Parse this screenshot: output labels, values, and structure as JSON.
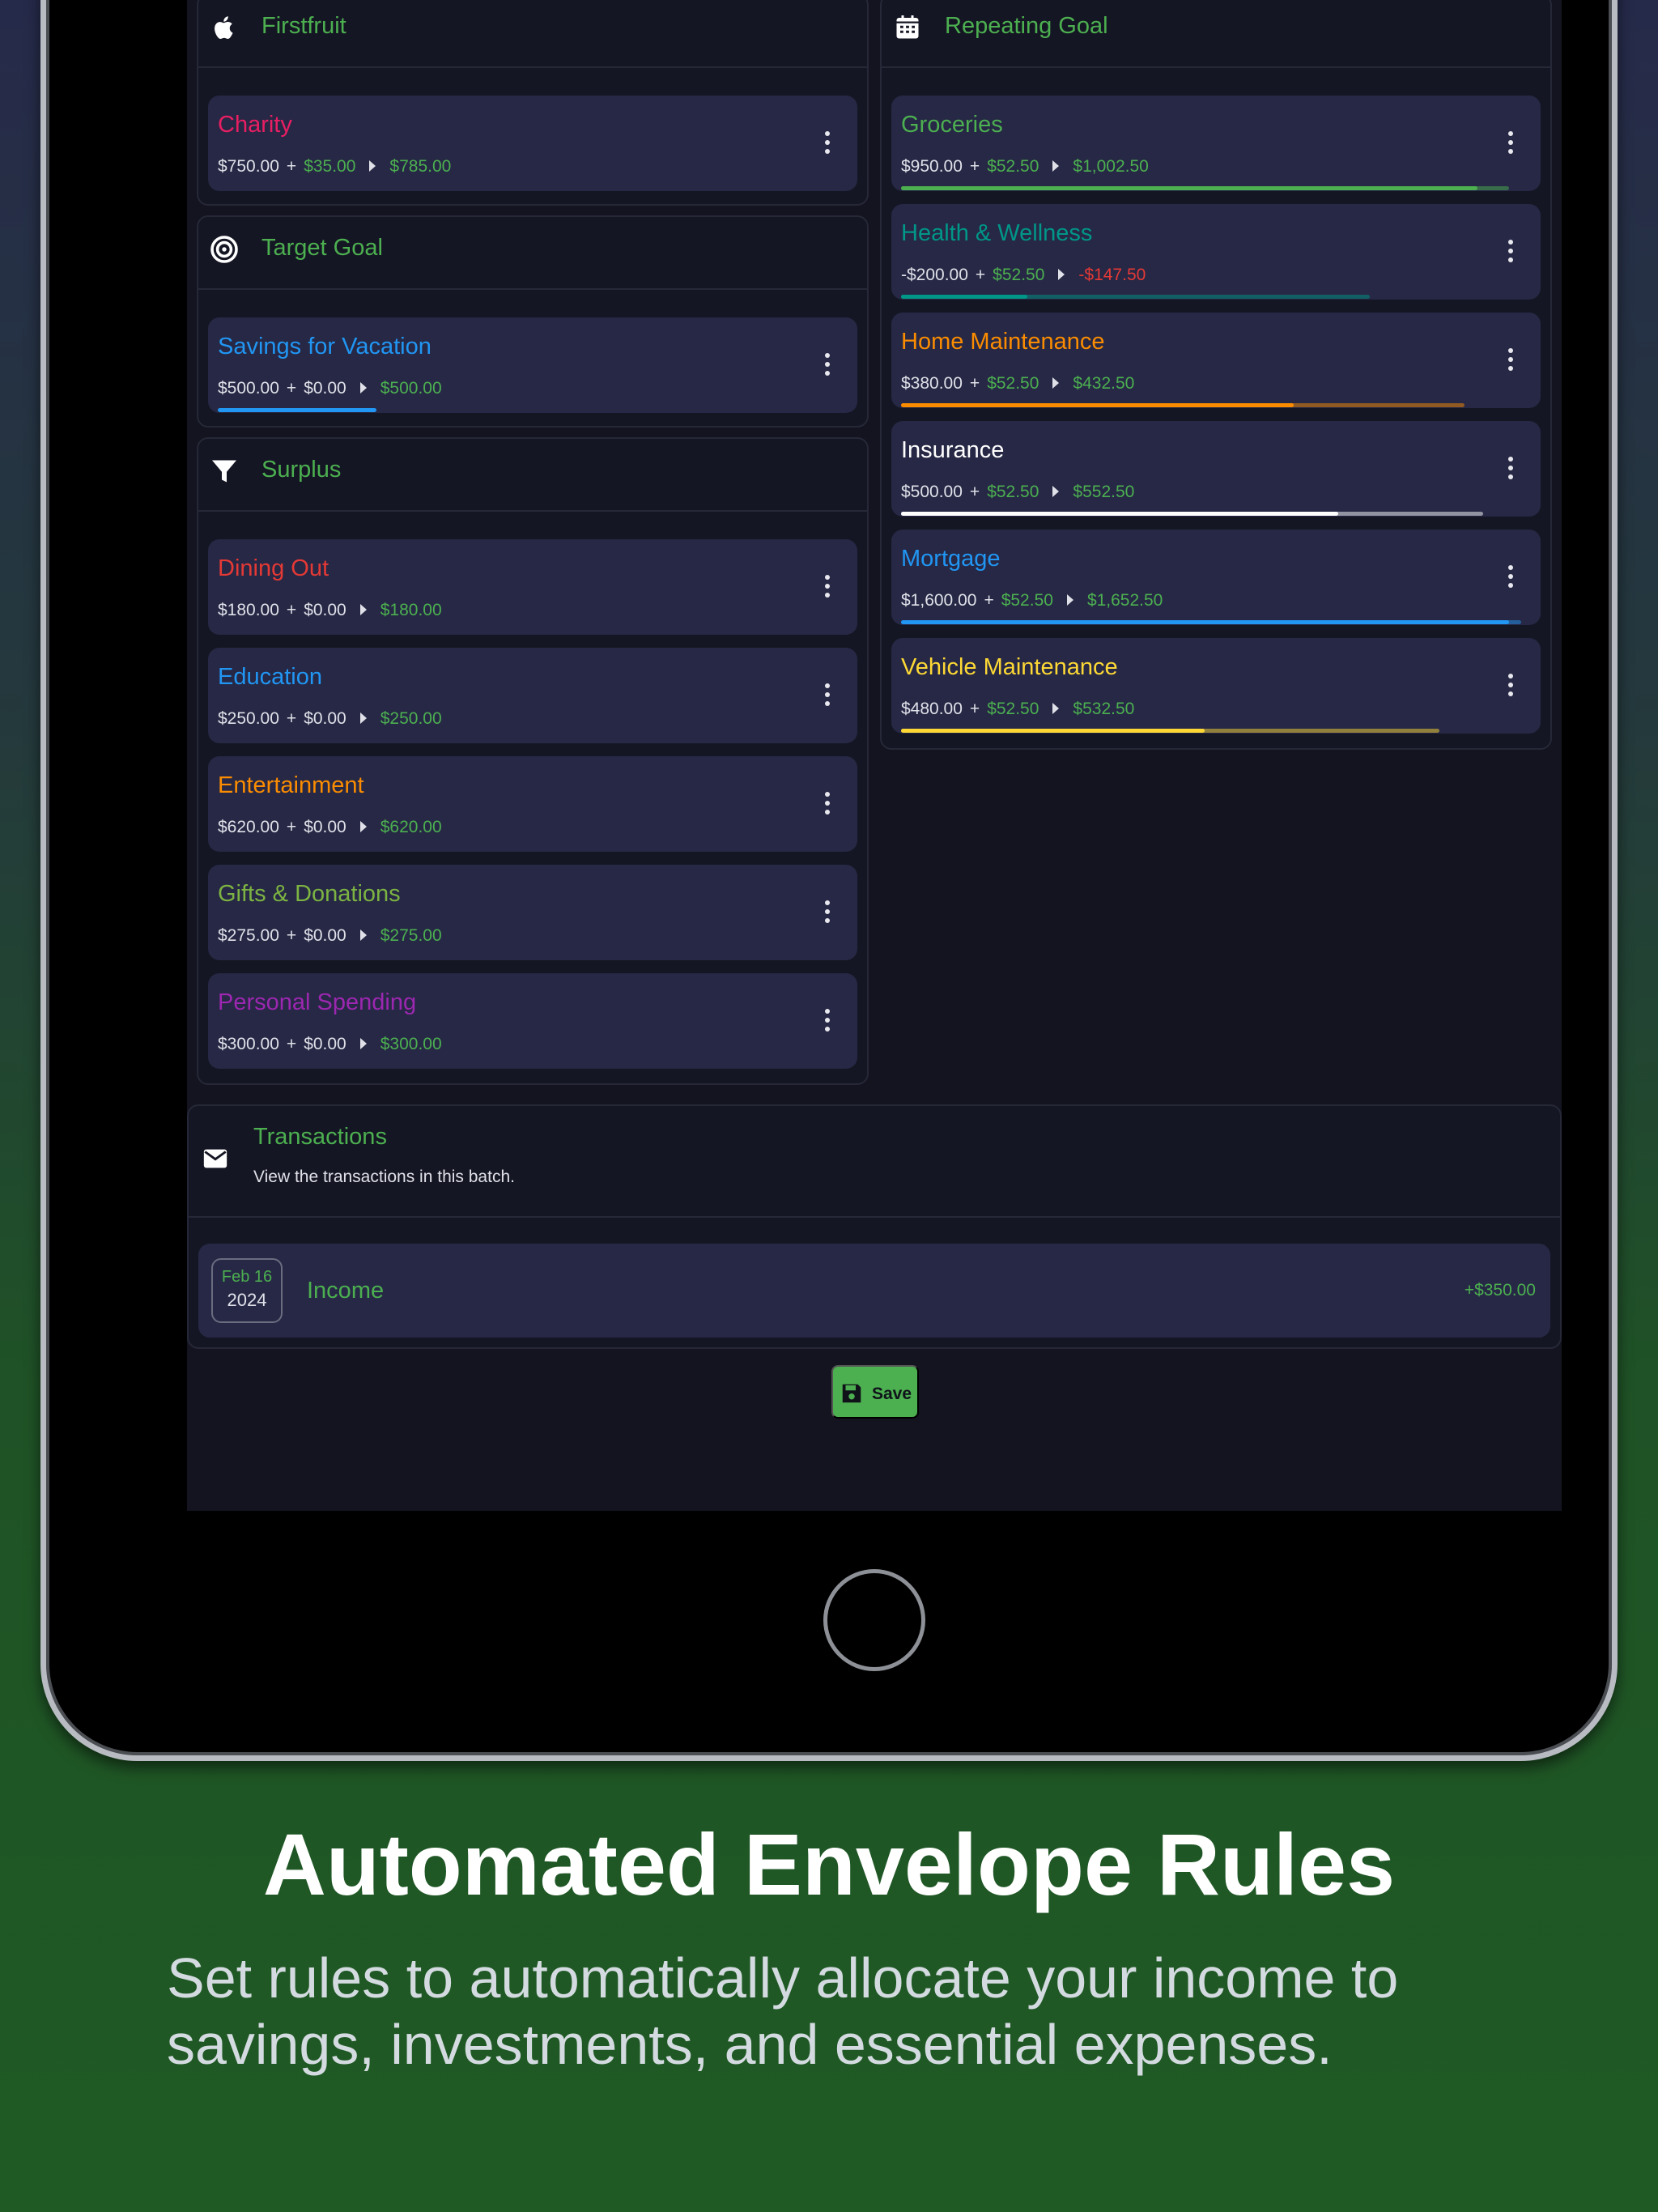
{
  "colors": {
    "accent_green": "#4caf50",
    "card_bg": "#262845",
    "screen_bg": "#13141f"
  },
  "sections": {
    "firstfruit": {
      "title": "Firstfruit",
      "icon": "apple-icon",
      "cards": [
        {
          "name": "Charity",
          "color": "#e91e63",
          "start": "$750.00",
          "add": "$35.00",
          "result": "$785.00"
        }
      ]
    },
    "target_goal": {
      "title": "Target Goal",
      "icon": "target-icon",
      "cards": [
        {
          "name": "Savings for Vacation",
          "color": "#2196f3",
          "start": "$500.00",
          "add": "$0.00",
          "result": "$500.00",
          "progress": 0.25
        }
      ]
    },
    "surplus": {
      "title": "Surplus",
      "icon": "funnel-icon",
      "cards": [
        {
          "name": "Dining Out",
          "color": "#e53935",
          "start": "$180.00",
          "add": "$0.00",
          "result": "$180.00"
        },
        {
          "name": "Education",
          "color": "#2196f3",
          "start": "$250.00",
          "add": "$0.00",
          "result": "$250.00"
        },
        {
          "name": "Entertainment",
          "color": "#fb8c00",
          "start": "$620.00",
          "add": "$0.00",
          "result": "$620.00"
        },
        {
          "name": "Gifts & Donations",
          "color": "#7cb342",
          "start": "$275.00",
          "add": "$0.00",
          "result": "$275.00"
        },
        {
          "name": "Personal Spending",
          "color": "#9c27b0",
          "start": "$300.00",
          "add": "$0.00",
          "result": "$300.00"
        }
      ]
    },
    "repeating_goal": {
      "title": "Repeating Goal",
      "icon": "calendar-icon",
      "cards": [
        {
          "name": "Groceries",
          "color": "#4caf50",
          "start": "$950.00",
          "add": "$52.50",
          "result": "$1,002.50",
          "progress_base": 0.91,
          "progress_total": 0.96
        },
        {
          "name": "Health & Wellness",
          "color": "#009688",
          "start": "-$200.00",
          "add": "$52.50",
          "result": "-$147.50",
          "result_negative": true,
          "progress_base": 0.2,
          "progress_total": 0.74
        },
        {
          "name": "Home Maintenance",
          "color": "#fb8c00",
          "start": "$380.00",
          "add": "$52.50",
          "result": "$432.50",
          "progress_base": 0.62,
          "progress_total": 0.89
        },
        {
          "name": "Insurance",
          "color": "#ffffff",
          "start": "$500.00",
          "add": "$52.50",
          "result": "$552.50",
          "progress_base": 0.69,
          "progress_total": 0.92
        },
        {
          "name": "Mortgage",
          "color": "#2196f3",
          "start": "$1,600.00",
          "add": "$52.50",
          "result": "$1,652.50",
          "progress_base": 0.96,
          "progress_total": 0.98
        },
        {
          "name": "Vehicle Maintenance",
          "color": "#fdd835",
          "start": "$480.00",
          "add": "$52.50",
          "result": "$532.50",
          "progress_base": 0.48,
          "progress_total": 0.85
        }
      ]
    }
  },
  "transactions": {
    "title": "Transactions",
    "subtitle": "View the transactions in this batch.",
    "icon": "envelope-icon",
    "items": [
      {
        "date_month_day": "Feb 16",
        "date_year": "2024",
        "name": "Income",
        "amount": "+$350.00"
      }
    ]
  },
  "save_button": {
    "label": "Save",
    "icon": "floppy-disk-icon"
  },
  "marketing": {
    "headline": "Automated Envelope Rules",
    "subline": "Set rules to automatically allocate your income to savings, investments, and essential expenses."
  }
}
